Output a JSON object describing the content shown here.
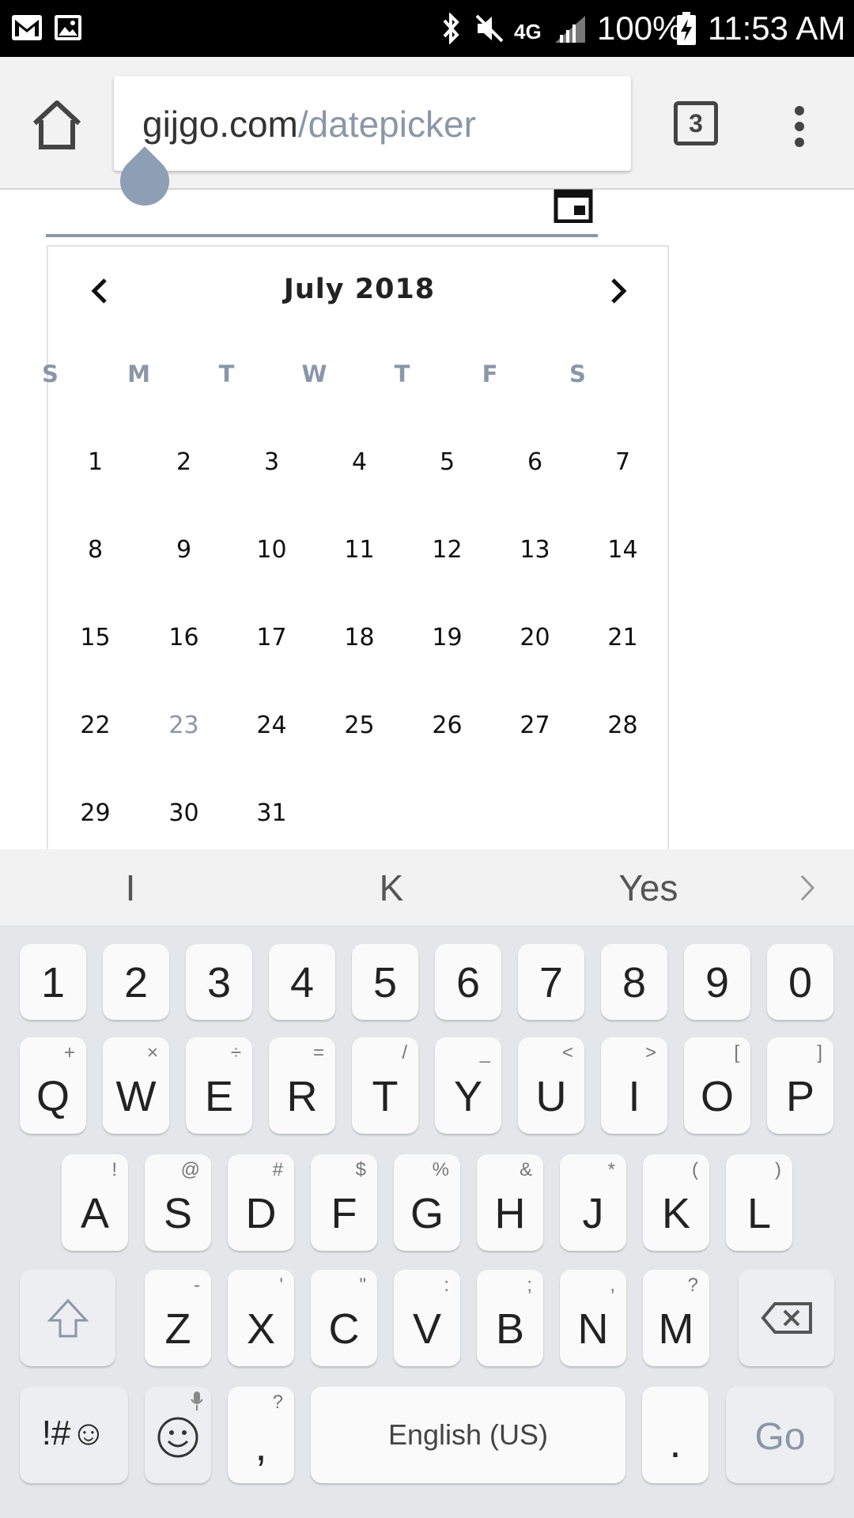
{
  "status_bar": {
    "battery": "100%",
    "time": "11:53 AM",
    "network": "4G",
    "icons": [
      "gmail-icon",
      "image-icon",
      "bluetooth-icon",
      "mute-icon",
      "lte-icon",
      "signal-icon",
      "battery-charging-icon"
    ]
  },
  "browser": {
    "url_domain": "gijgo.com",
    "url_path": "/datepicker",
    "tab_count": "3"
  },
  "calendar": {
    "month_title": "July 2018",
    "weekdays": [
      "S",
      "M",
      "T",
      "W",
      "T",
      "F",
      "S"
    ],
    "weeks": [
      [
        "1",
        "2",
        "3",
        "4",
        "5",
        "6",
        "7"
      ],
      [
        "8",
        "9",
        "10",
        "11",
        "12",
        "13",
        "14"
      ],
      [
        "15",
        "16",
        "17",
        "18",
        "19",
        "20",
        "21"
      ],
      [
        "22",
        "23",
        "24",
        "25",
        "26",
        "27",
        "28"
      ],
      [
        "29",
        "30",
        "31",
        "",
        "",
        "",
        ""
      ]
    ],
    "highlighted_day": "23",
    "highlight_color": "#8a97a8"
  },
  "keyboard": {
    "suggestions": [
      "I",
      "K",
      "Yes"
    ],
    "number_row": [
      "1",
      "2",
      "3",
      "4",
      "5",
      "6",
      "7",
      "8",
      "9",
      "0"
    ],
    "row1": [
      {
        "key": "Q",
        "sub": "+"
      },
      {
        "key": "W",
        "sub": "×"
      },
      {
        "key": "E",
        "sub": "÷"
      },
      {
        "key": "R",
        "sub": "="
      },
      {
        "key": "T",
        "sub": "/"
      },
      {
        "key": "Y",
        "sub": "_"
      },
      {
        "key": "U",
        "sub": "<"
      },
      {
        "key": "I",
        "sub": ">"
      },
      {
        "key": "O",
        "sub": "["
      },
      {
        "key": "P",
        "sub": "]"
      }
    ],
    "row2": [
      {
        "key": "A",
        "sub": "!"
      },
      {
        "key": "S",
        "sub": "@"
      },
      {
        "key": "D",
        "sub": "#"
      },
      {
        "key": "F",
        "sub": "$"
      },
      {
        "key": "G",
        "sub": "%"
      },
      {
        "key": "H",
        "sub": "&"
      },
      {
        "key": "J",
        "sub": "*"
      },
      {
        "key": "K",
        "sub": "("
      },
      {
        "key": "L",
        "sub": ")"
      }
    ],
    "row3": [
      {
        "key": "Z",
        "sub": "-"
      },
      {
        "key": "X",
        "sub": "'"
      },
      {
        "key": "C",
        "sub": "\""
      },
      {
        "key": "V",
        "sub": ":"
      },
      {
        "key": "B",
        "sub": ";"
      },
      {
        "key": "N",
        "sub": ","
      },
      {
        "key": "M",
        "sub": "?"
      }
    ],
    "symbols_key": "!#☺",
    "comma_key": ",",
    "comma_sub": "?",
    "space_label": "English (US)",
    "period_key": ".",
    "go_key": "Go"
  }
}
